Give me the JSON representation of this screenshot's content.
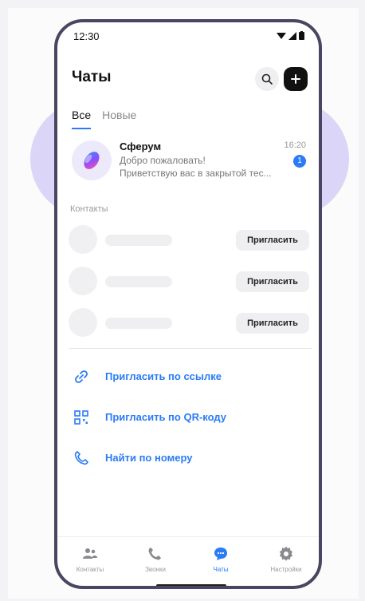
{
  "status_bar": {
    "time": "12:30"
  },
  "header": {
    "title": "Чаты"
  },
  "tabs": [
    {
      "label": "Все",
      "active": true
    },
    {
      "label": "Новые",
      "active": false
    }
  ],
  "chat": {
    "name": "Сферум",
    "time": "16:20",
    "line1": "Добро пожаловать!",
    "line2": "Приветствую вас в закрытой тес...",
    "badge": "1"
  },
  "contacts": {
    "section_label": "Контакты",
    "invite_label": "Пригласить",
    "rows": [
      1,
      2,
      3
    ]
  },
  "actions": [
    {
      "label": "Пригласить по ссылке",
      "icon": "link-icon"
    },
    {
      "label": "Пригласить по QR-коду",
      "icon": "qr-code-icon"
    },
    {
      "label": "Найти по номеру",
      "icon": "phone-icon"
    }
  ],
  "bottom_nav": [
    {
      "label": "Контакты",
      "icon": "contacts-icon",
      "active": false
    },
    {
      "label": "Звонки",
      "icon": "phone-icon",
      "active": false
    },
    {
      "label": "Чаты",
      "icon": "chat-bubble-icon",
      "active": true
    },
    {
      "label": "Настройки",
      "icon": "gear-icon",
      "active": false
    }
  ],
  "colors": {
    "accent": "#2a7bf5",
    "frame": "#4a4560",
    "highlight": "#ada0f0"
  }
}
